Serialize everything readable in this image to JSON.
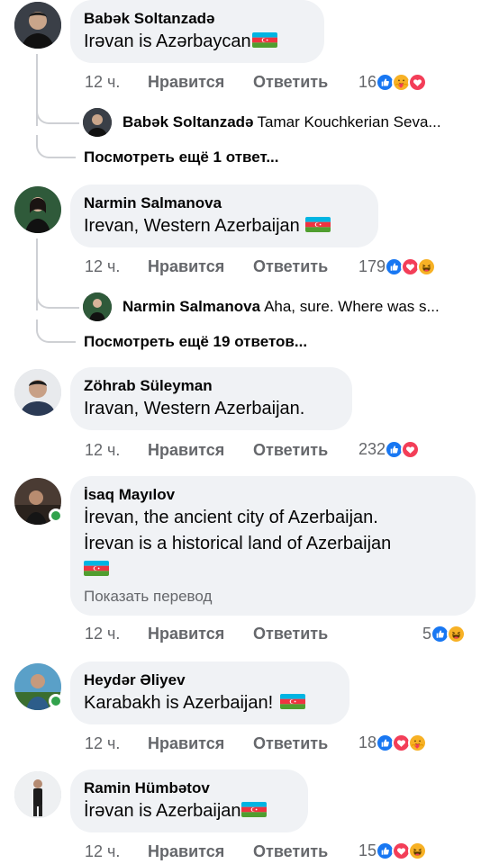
{
  "comments": [
    {
      "author": "Babək Soltanzadə",
      "text": "Irəvan is  Azərbaycan",
      "time": "12 ч.",
      "like": "Нравится",
      "reply": "Ответить",
      "reaction_count": "16",
      "reactions": [
        "like-icon",
        "care-icon",
        "love-icon"
      ],
      "reply_preview": {
        "author": "Babək Soltanzadə",
        "text": "Tamar Kouchkerian Seva..."
      },
      "more_replies": "Посмотреть ещё 1 ответ..."
    },
    {
      "author": "Narmin  Salmanova",
      "text": "Irevan, Western Azerbaijan",
      "time": "12 ч.",
      "like": "Нравится",
      "reply": "Ответить",
      "reaction_count": "179",
      "reactions": [
        "like-icon",
        "love-icon",
        "haha-icon"
      ],
      "reply_preview": {
        "author": "Narmin  Salmanova",
        "text": "Aha, sure. Where was s..."
      },
      "more_replies": "Посмотреть ещё 19 ответов..."
    },
    {
      "author": "Zöhrab Süleyman",
      "text": "Iravan, Western Azerbaijan.",
      "time": "12 ч.",
      "like": "Нравится",
      "reply": "Ответить",
      "reaction_count": "232",
      "reactions": [
        "like-icon",
        "love-icon"
      ]
    },
    {
      "author": "İsaq Mayılov",
      "text_lines": [
        "İrevan, the ancient city of Azerbaijan.",
        "İrevan is a historical land of Azerbaijan"
      ],
      "translate": "Показать перевод",
      "time": "12 ч.",
      "like": "Нравится",
      "reply": "Ответить",
      "reaction_count": "5",
      "reactions": [
        "like-icon",
        "haha-icon"
      ]
    },
    {
      "author": "Heydər Əliyev",
      "text": "Karabakh is Azerbaijan!",
      "time": "12 ч.",
      "like": "Нравится",
      "reply": "Ответить",
      "reaction_count": "18",
      "reactions": [
        "like-icon",
        "love-icon",
        "care-icon"
      ]
    },
    {
      "author": "Ramin Hümbətov",
      "text": "İrəvan is Azerbaijan",
      "time": "12 ч.",
      "like": "Нравится",
      "reply": "Ответить",
      "reaction_count": "15",
      "reactions": [
        "like-icon",
        "love-icon",
        "haha-icon"
      ]
    }
  ],
  "colors": {
    "bubble": "#f0f2f5",
    "secondary_text": "#65676b",
    "like_blue": "#1877f2",
    "love_red": "#f33e58",
    "haha_yellow": "#f7b125",
    "online_green": "#31a24c"
  }
}
